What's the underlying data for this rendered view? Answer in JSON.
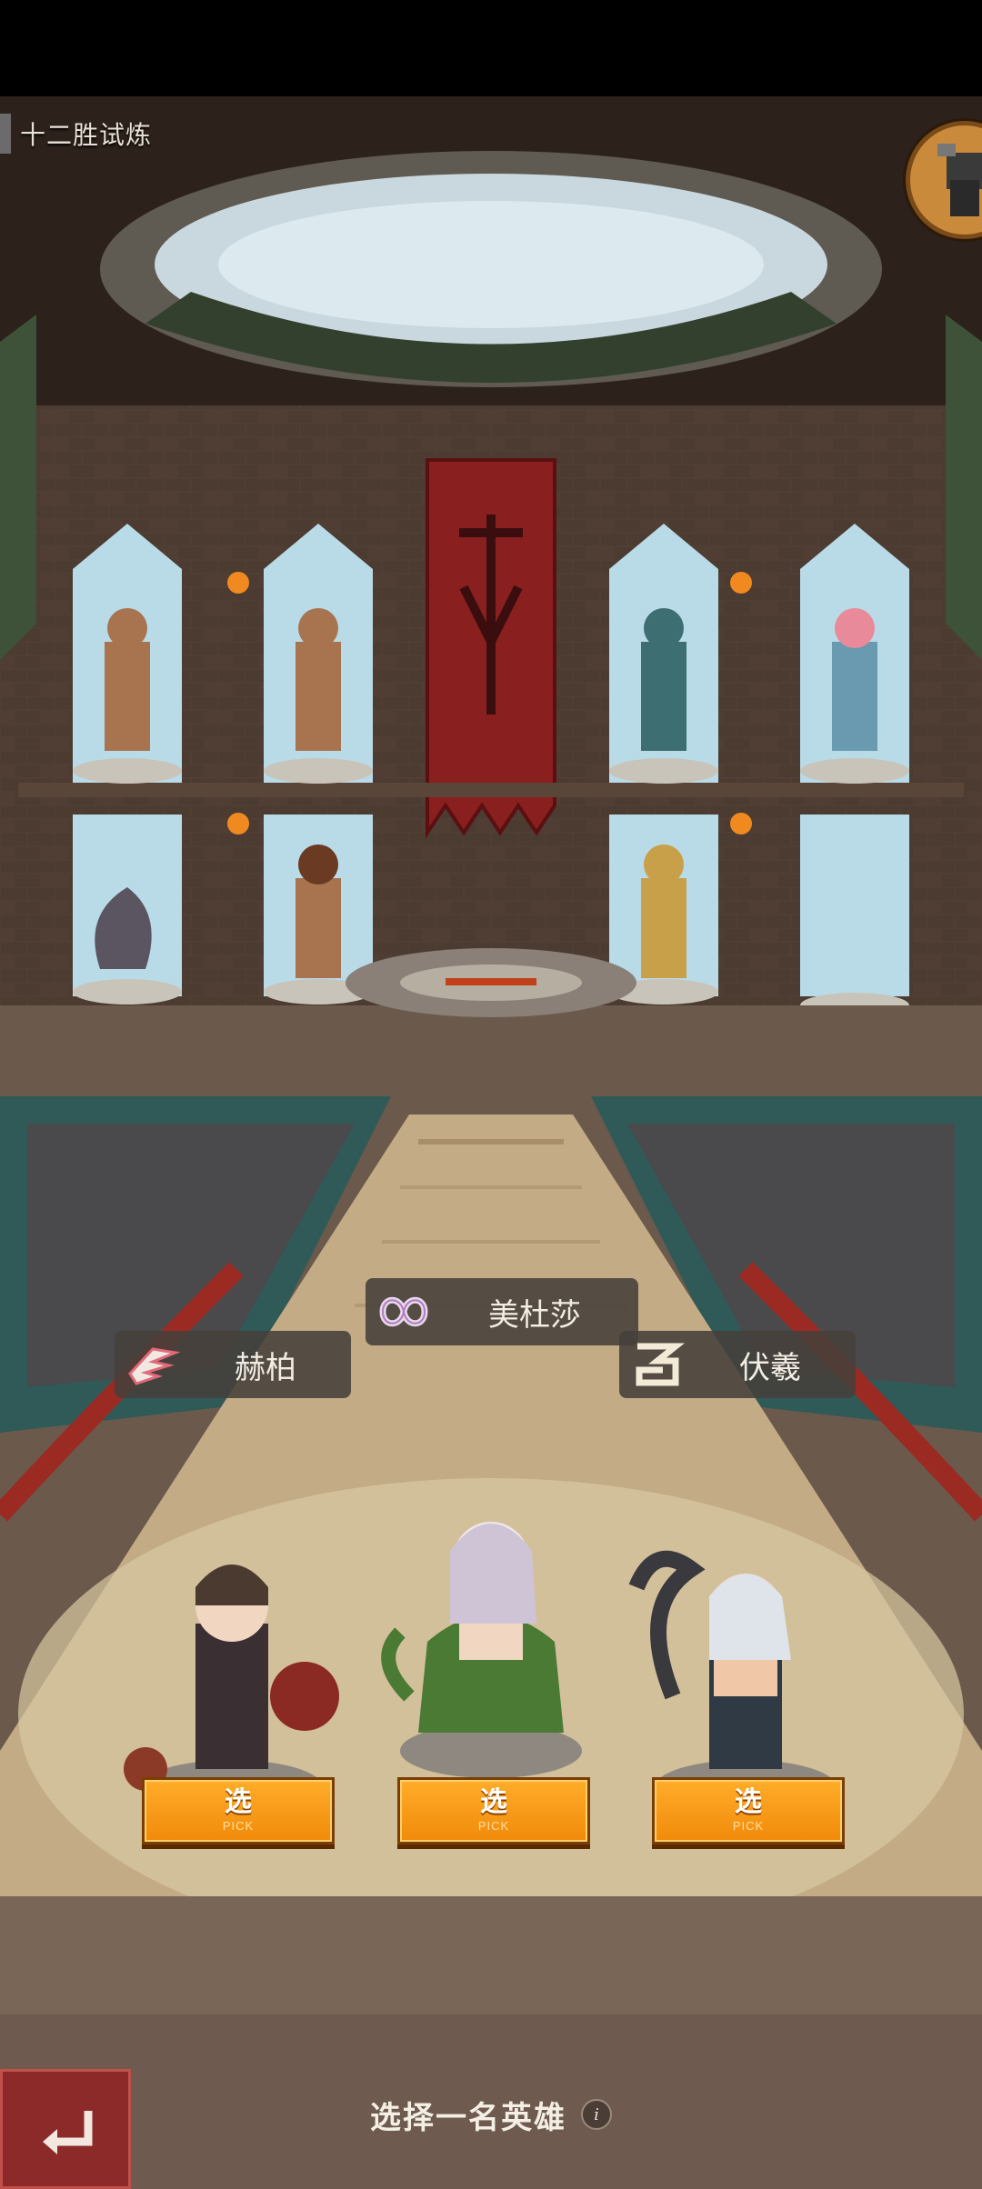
{
  "mode": {
    "title": "十二胜试炼"
  },
  "heroes": [
    {
      "name": "赫柏",
      "emblem": "wing-icon",
      "pick_label": "选",
      "pick_sub": "PICK"
    },
    {
      "name": "美杜莎",
      "emblem": "infinity-icon",
      "pick_label": "选",
      "pick_sub": "PICK"
    },
    {
      "name": "伏羲",
      "emblem": "swirl-icon",
      "pick_label": "选",
      "pick_sub": "PICK"
    }
  ],
  "footer": {
    "prompt": "选择一名英雄",
    "info_icon": "info-icon",
    "back_icon": "back-arrow-icon"
  },
  "colors": {
    "pick_button": "#f59a14",
    "back_button": "#8c2a2a",
    "banner": "#8a1f1f"
  }
}
